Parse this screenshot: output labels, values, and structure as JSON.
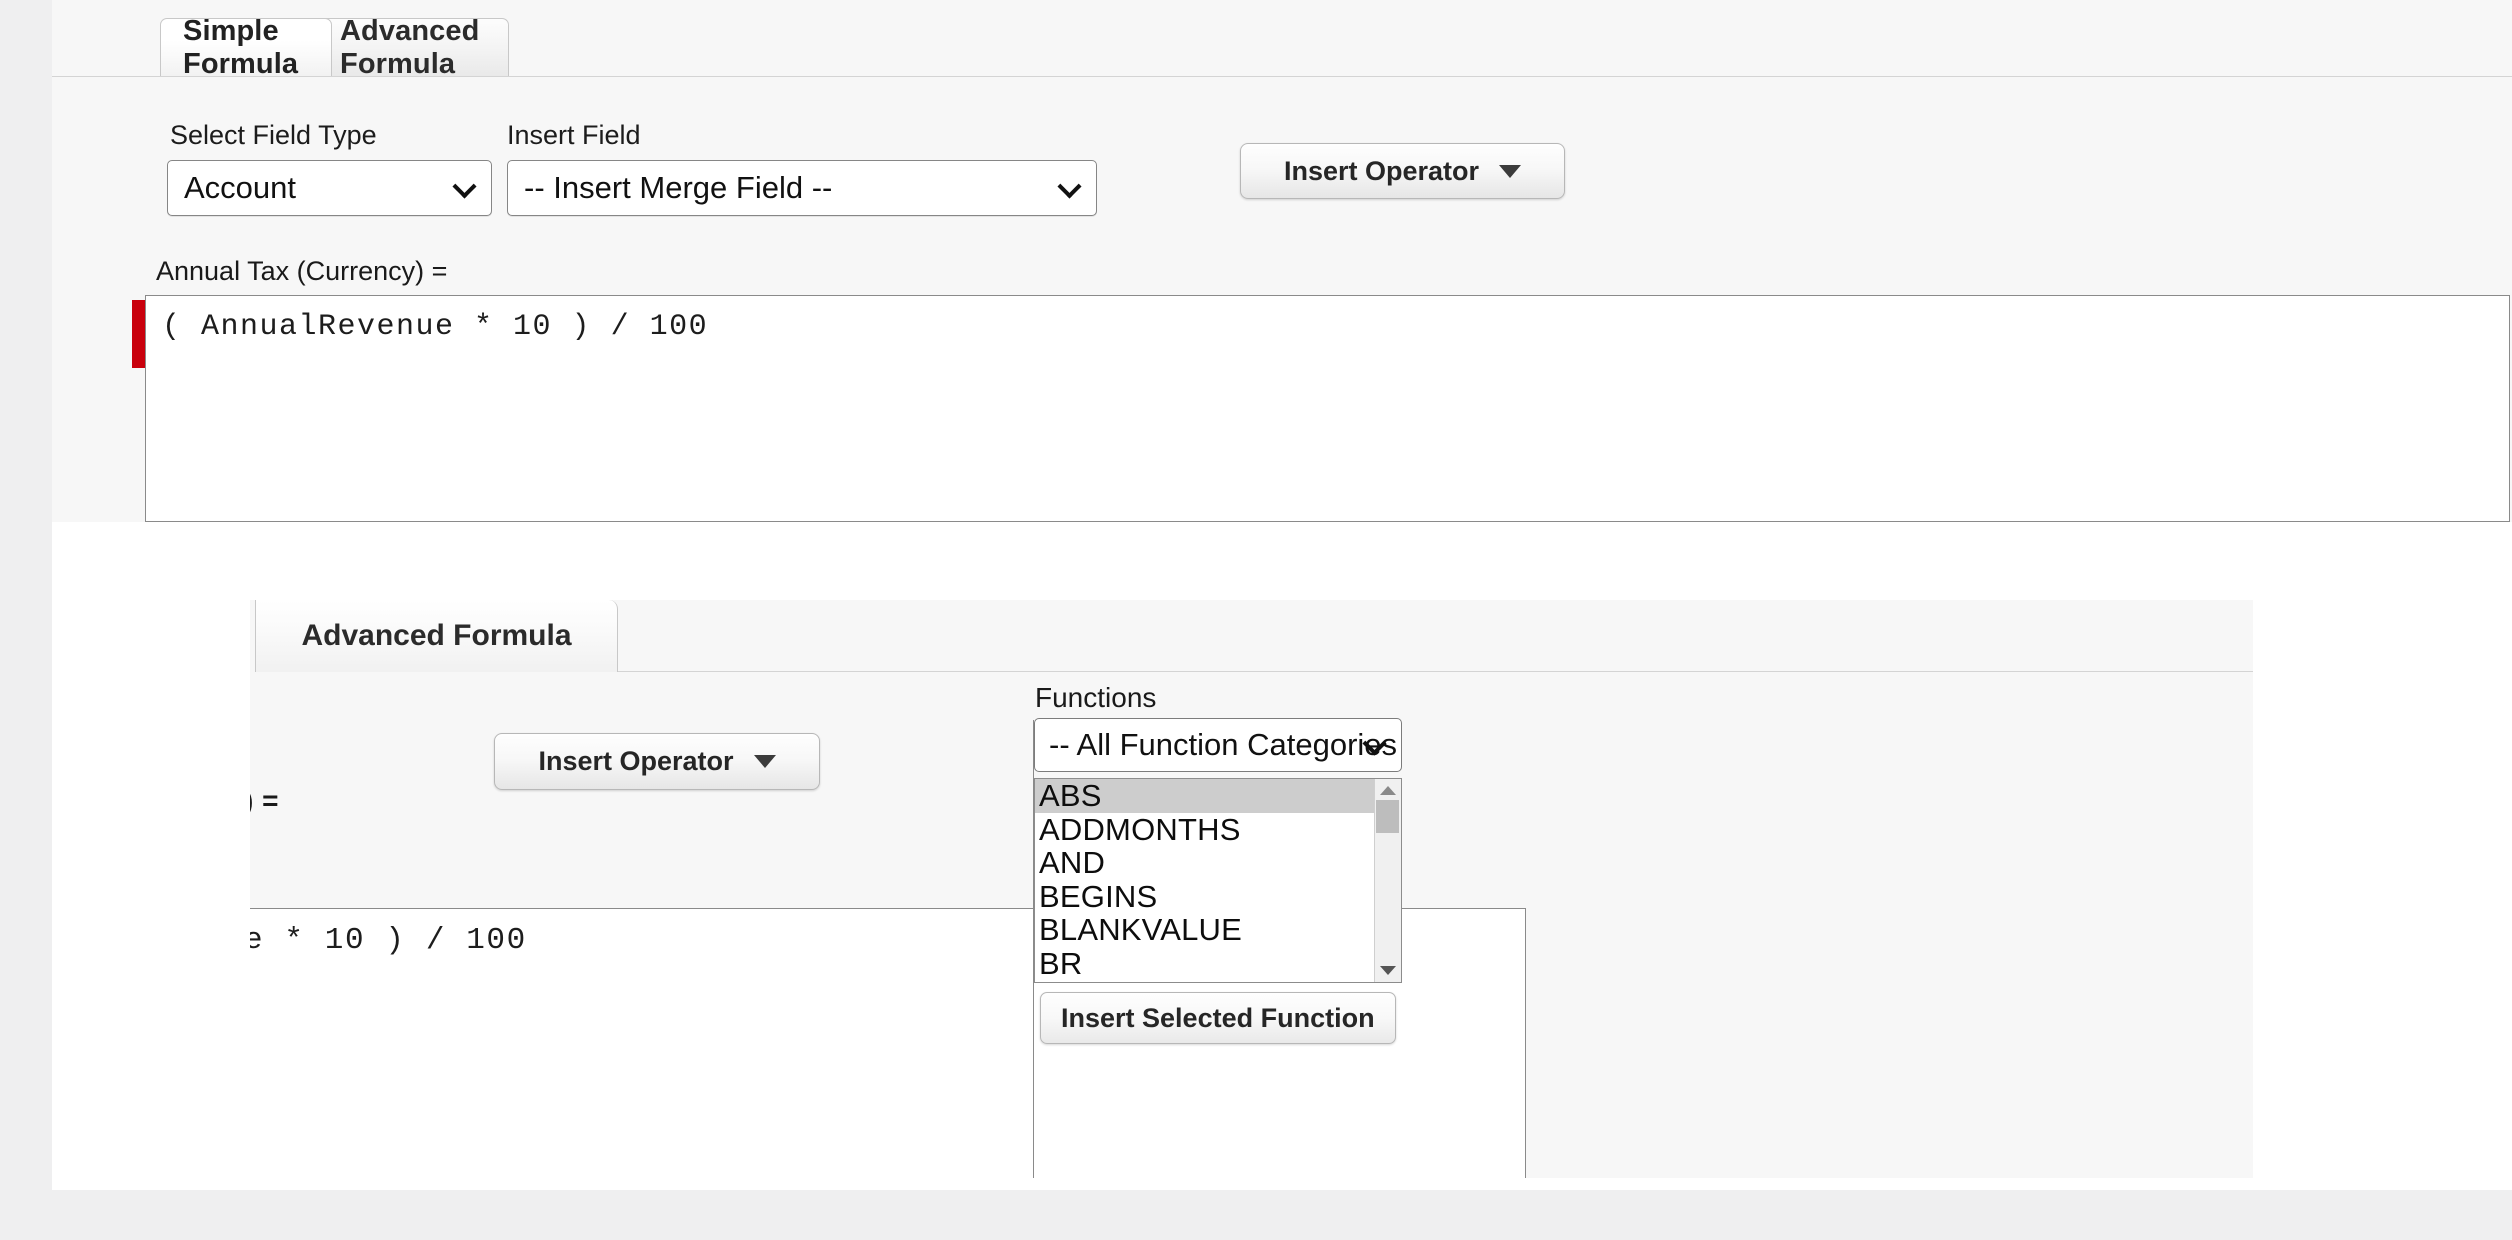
{
  "outer_editor": {
    "tabs": [
      {
        "label": "Simple Formula",
        "active": true
      },
      {
        "label": "Advanced Formula",
        "active": false
      }
    ],
    "field_type": {
      "label": "Select Field Type",
      "value": "Account"
    },
    "insert_field": {
      "label": "Insert Field",
      "value": "-- Insert Merge Field --"
    },
    "insert_operator_label": "Insert Operator",
    "formula_label": "Annual Tax (Currency) =",
    "formula_text": "( AnnualRevenue * 10 ) / 100",
    "cursor_marker_color": "#c9000c"
  },
  "inner_editor": {
    "tab_label": "Advanced Formula",
    "insert_operator_label": "Insert Operator",
    "formula_label_partial": ") =",
    "formula_text_partial": "e * 10 ) / 100",
    "functions": {
      "label": "Functions",
      "category_value": "-- All Function Categories --",
      "items": [
        {
          "name": "ABS",
          "selected": true
        },
        {
          "name": "ADDMONTHS",
          "selected": false
        },
        {
          "name": "AND",
          "selected": false
        },
        {
          "name": "BEGINS",
          "selected": false
        },
        {
          "name": "BLANKVALUE",
          "selected": false
        },
        {
          "name": "BR",
          "selected": false
        }
      ],
      "insert_button_label": "Insert Selected Function"
    }
  },
  "theme": {
    "page_background": "#efeff0",
    "panel_background": "#f7f7f7",
    "canvas_background": "#ffffff",
    "selection_highlight": "#cdcdcd",
    "border": "#c8c8c8"
  }
}
